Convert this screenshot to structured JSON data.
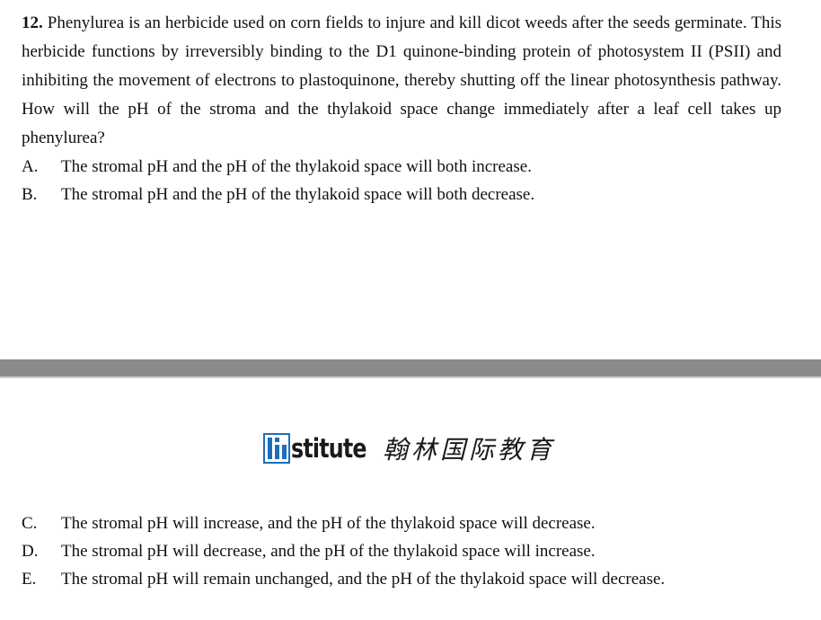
{
  "question": {
    "number": "12.",
    "text": "Phenylurea is an herbicide used on corn fields to injure and kill dicot weeds after the seeds germinate. This herbicide functions by irreversibly binding to the D1 quinone-binding protein of photosystem II (PSII) and inhibiting the movement of electrons to plastoquinone, thereby shutting off the linear photosynthesis pathway. How will the pH of the stroma and the thylakoid space change immediately after a leaf cell takes up phenylurea?"
  },
  "options_top": [
    {
      "letter": "A.",
      "text": "The stromal pH and the pH of the thylakoid space will both increase."
    },
    {
      "letter": "B.",
      "text": "The stromal pH and the pH of the thylakoid space will both decrease."
    }
  ],
  "options_bottom": [
    {
      "letter": "C.",
      "text": "The stromal pH will increase, and the pH of the thylakoid space will decrease."
    },
    {
      "letter": "D.",
      "text": "The stromal pH will decrease, and the pH of the thylakoid space will increase."
    },
    {
      "letter": "E.",
      "text": "The stromal pH will remain unchanged, and the pH of the thylakoid space will decrease."
    }
  ],
  "logo": {
    "word": "stitute",
    "chinese": "翰林国际教育",
    "accent_color": "#1c6fb8"
  }
}
